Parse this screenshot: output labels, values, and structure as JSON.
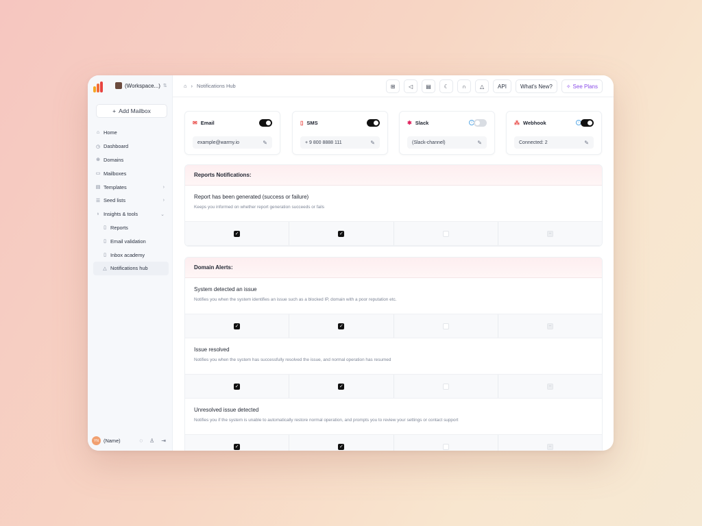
{
  "colors": {
    "accent": "#8a4de8",
    "toggle_on": "#111111",
    "section_header": "#fdeef0"
  },
  "sidebar": {
    "workspace": "(Workspace...)",
    "add_mailbox": "Add Mailbox",
    "items": [
      {
        "label": "Home",
        "icon": "home-icon"
      },
      {
        "label": "Dashboard",
        "icon": "dashboard-icon"
      },
      {
        "label": "Domains",
        "icon": "domains-icon"
      },
      {
        "label": "Mailboxes",
        "icon": "mailboxes-icon"
      },
      {
        "label": "Templates",
        "icon": "templates-icon"
      },
      {
        "label": "Seed lists",
        "icon": "seed-lists-icon"
      },
      {
        "label": "Insights & tools",
        "icon": "lightbulb-icon"
      },
      {
        "label": "Reports",
        "icon": "reports-icon"
      },
      {
        "label": "Email validation",
        "icon": "email-validation-icon"
      },
      {
        "label": "Inbox  academy",
        "icon": "academy-icon"
      },
      {
        "label": "Notifications hub",
        "icon": "bell-icon"
      }
    ],
    "user": {
      "name": "(Name)",
      "initials": "YN"
    }
  },
  "topbar": {
    "breadcrumb": "Notifications Hub",
    "api": "API",
    "whats_new": "What's New?",
    "see_plans": "See Plans"
  },
  "channels": [
    {
      "name": "Email",
      "value": "example@warmy.io",
      "enabled": true
    },
    {
      "name": "SMS",
      "value": "+ 9 800 8888 111",
      "enabled": true
    },
    {
      "name": "Slack",
      "value": "(Slack-channel)",
      "enabled": false
    },
    {
      "name": "Webhook",
      "value": "Connected: 2",
      "enabled": true
    }
  ],
  "sections": [
    {
      "title": "Reports Notifications:",
      "items": [
        {
          "title": "Report has been generated (success or failure)",
          "desc": "Keeps you informed on whether report generation succeeds or fails"
        }
      ]
    },
    {
      "title": "Domain Alerts:",
      "items": [
        {
          "title": "System detected an issue",
          "desc": "Notifies you when the system identifies an issue such as a blocked IP, domain with a poor reputation etc."
        },
        {
          "title": "Issue resolved",
          "desc": "Notifies you when the system has successfully resolved the issue, and normal operation has resumed"
        },
        {
          "title": "Unresolved issue detected",
          "desc": "Notifies you if the system is unable to automatically restore normal operation, and prompts you to review your settings or contact support"
        }
      ]
    }
  ]
}
